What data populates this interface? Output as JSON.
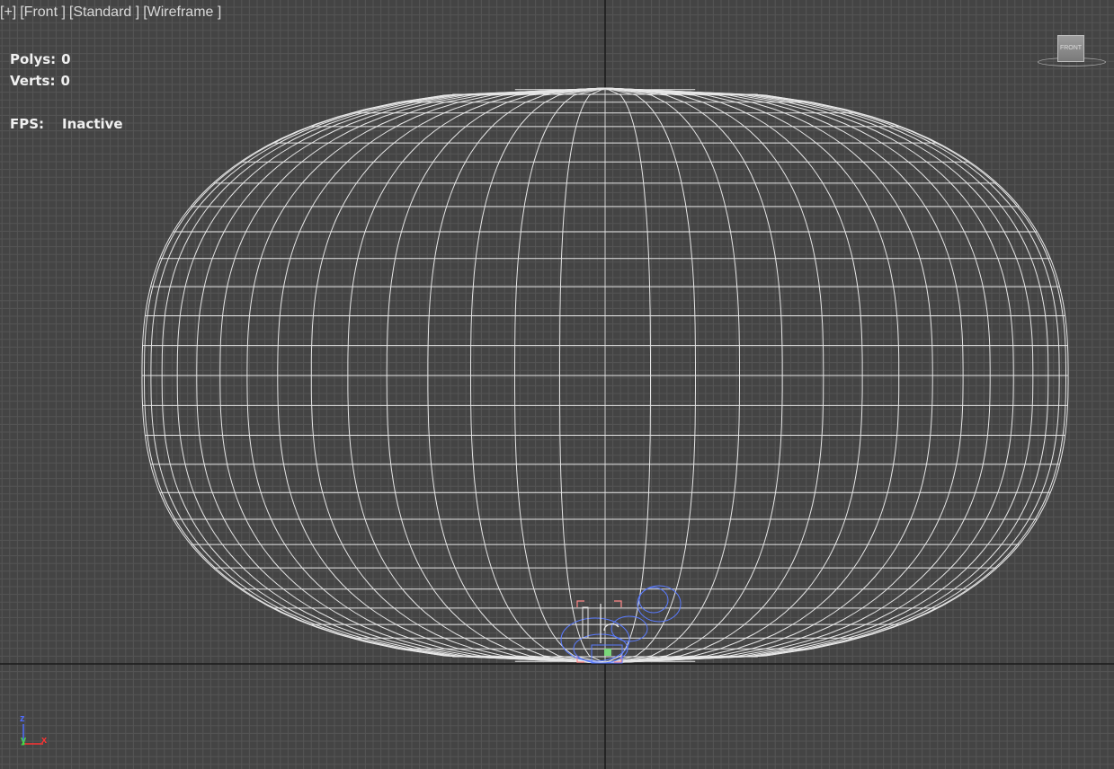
{
  "viewport": {
    "labels": [
      "[+]",
      "[Front ]",
      "[Standard ]",
      "[Wireframe ]"
    ],
    "background_color": "#444444",
    "grid_color": "#555555",
    "axis_line_color": "#1a1a1a"
  },
  "stats": {
    "polys_label": "Polys:",
    "polys_value": "0",
    "verts_label": "Verts:",
    "verts_value": "0",
    "fps_label": "FPS:",
    "fps_value": "Inactive"
  },
  "viewcube": {
    "face_label": "FRONT"
  },
  "axis_tripod": {
    "z": "z",
    "y": "y",
    "x": "x",
    "z_color": "#4f6cff",
    "y_color": "#44dd44",
    "x_color": "#ff3333"
  },
  "scene": {
    "wireframe_color": "#e6e6e6",
    "selected_object_color": "#5a7bff",
    "helper_color": "#ff8888"
  }
}
